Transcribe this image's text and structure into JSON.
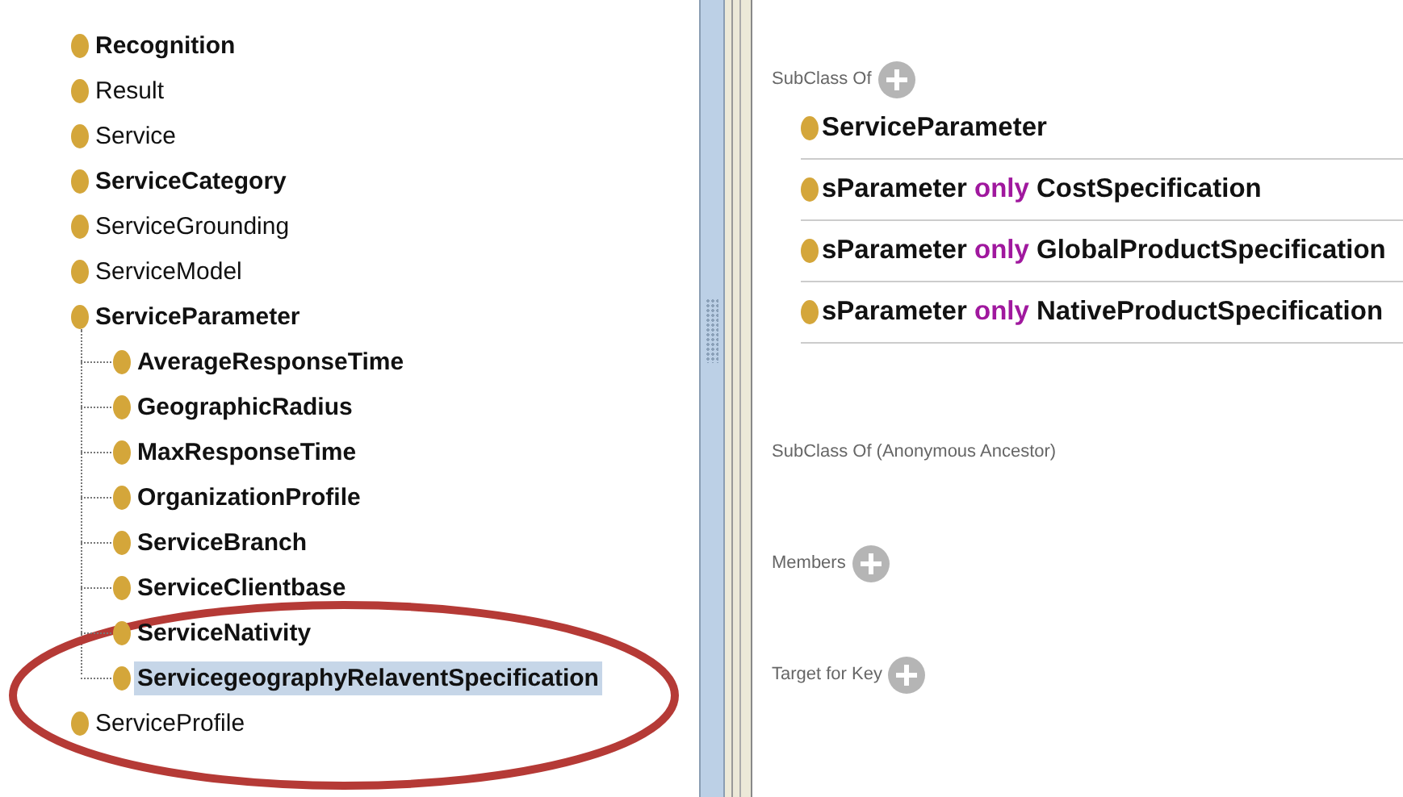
{
  "class_tree": [
    {
      "label": "Recognition",
      "bold": true,
      "selected": false
    },
    {
      "label": "Result",
      "bold": false,
      "selected": false
    },
    {
      "label": "Service",
      "bold": false,
      "selected": false
    },
    {
      "label": "ServiceCategory",
      "bold": true,
      "selected": false
    },
    {
      "label": "ServiceGrounding",
      "bold": false,
      "selected": false
    },
    {
      "label": "ServiceModel",
      "bold": false,
      "selected": false
    },
    {
      "label": "ServiceParameter",
      "bold": true,
      "selected": false,
      "children": [
        {
          "label": "AverageResponseTime",
          "bold": true,
          "selected": false
        },
        {
          "label": "GeographicRadius",
          "bold": true,
          "selected": false
        },
        {
          "label": "MaxResponseTime",
          "bold": true,
          "selected": false
        },
        {
          "label": "OrganizationProfile",
          "bold": true,
          "selected": false
        },
        {
          "label": "ServiceBranch",
          "bold": true,
          "selected": false
        },
        {
          "label": "ServiceClientbase",
          "bold": true,
          "selected": false
        },
        {
          "label": "ServiceNativity",
          "bold": true,
          "selected": false
        },
        {
          "label": "ServicegeographyRelaventSpecification",
          "bold": true,
          "selected": true
        }
      ]
    },
    {
      "label": "ServiceProfile",
      "bold": false,
      "selected": false
    }
  ],
  "description": {
    "subclass_of": {
      "label": "SubClass Of",
      "items": [
        {
          "kind": "class",
          "text": "ServiceParameter"
        },
        {
          "kind": "restriction",
          "property": "sParameter",
          "keyword": "only",
          "filler": "CostSpecification"
        },
        {
          "kind": "restriction",
          "property": "sParameter",
          "keyword": "only",
          "filler": "GlobalProductSpecification"
        },
        {
          "kind": "restriction",
          "property": "sParameter",
          "keyword": "only",
          "filler": "NativeProductSpecification"
        }
      ]
    },
    "sections": [
      {
        "label": "SubClass Of (Anonymous Ancestor)",
        "add_button": false
      },
      {
        "label": "Members",
        "add_button": true
      },
      {
        "label": "Target for Key",
        "add_button": true
      }
    ]
  }
}
